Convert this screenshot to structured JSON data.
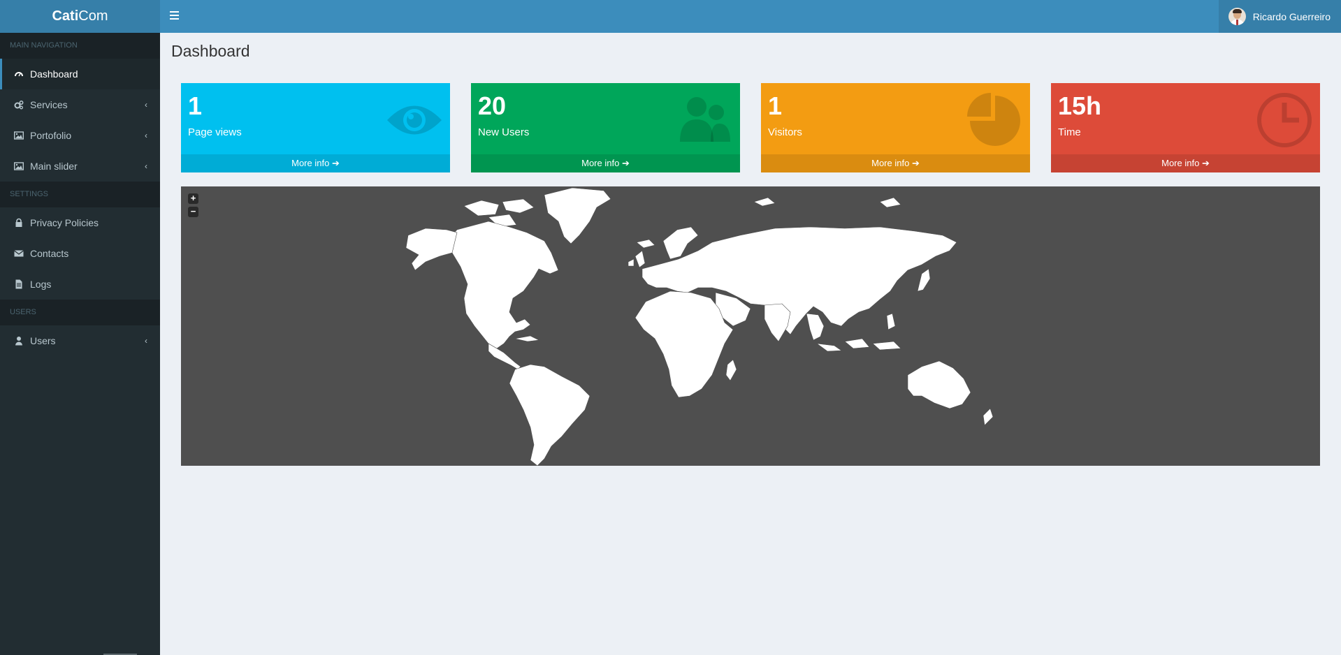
{
  "header": {
    "logo_bold": "Cati",
    "logo_rest": "Com",
    "user_name": "Ricardo Guerreiro"
  },
  "sidebar": {
    "main_nav_label": "MAIN NAVIGATION",
    "settings_label": "SETTINGS",
    "users_label": "USERS",
    "items": [
      {
        "label": "Dashboard",
        "icon": "dashboard-icon",
        "active": true
      },
      {
        "label": "Services",
        "icon": "cogs-icon",
        "has_submenu": true
      },
      {
        "label": "Portofolio",
        "icon": "image-icon",
        "has_submenu": true
      },
      {
        "label": "Main slider",
        "icon": "image-icon",
        "has_submenu": true
      },
      {
        "label": "Privacy Policies",
        "icon": "lock-icon"
      },
      {
        "label": "Contacts",
        "icon": "envelope-icon"
      },
      {
        "label": "Logs",
        "icon": "file-icon"
      },
      {
        "label": "Users",
        "icon": "user-icon",
        "has_submenu": true
      }
    ],
    "chevron": "‹"
  },
  "main": {
    "page_title": "Dashboard",
    "boxes": [
      {
        "value": "1",
        "label": "Page views",
        "more": "More info",
        "color": "#00c0ef",
        "icon": "eye-icon"
      },
      {
        "value": "20",
        "label": "New Users",
        "more": "More info",
        "color": "#00a65a",
        "icon": "users-icon"
      },
      {
        "value": "1",
        "label": "Visitors",
        "more": "More info",
        "color": "#f39c12",
        "icon": "pie-chart-icon"
      },
      {
        "value": "15h",
        "label": "Time",
        "more": "More info",
        "color": "#dd4b39",
        "icon": "clock-icon"
      }
    ],
    "map": {
      "zoom_in": "+",
      "zoom_out": "−",
      "land_color": "#ffffff",
      "background_color": "#4f4f4f"
    }
  }
}
